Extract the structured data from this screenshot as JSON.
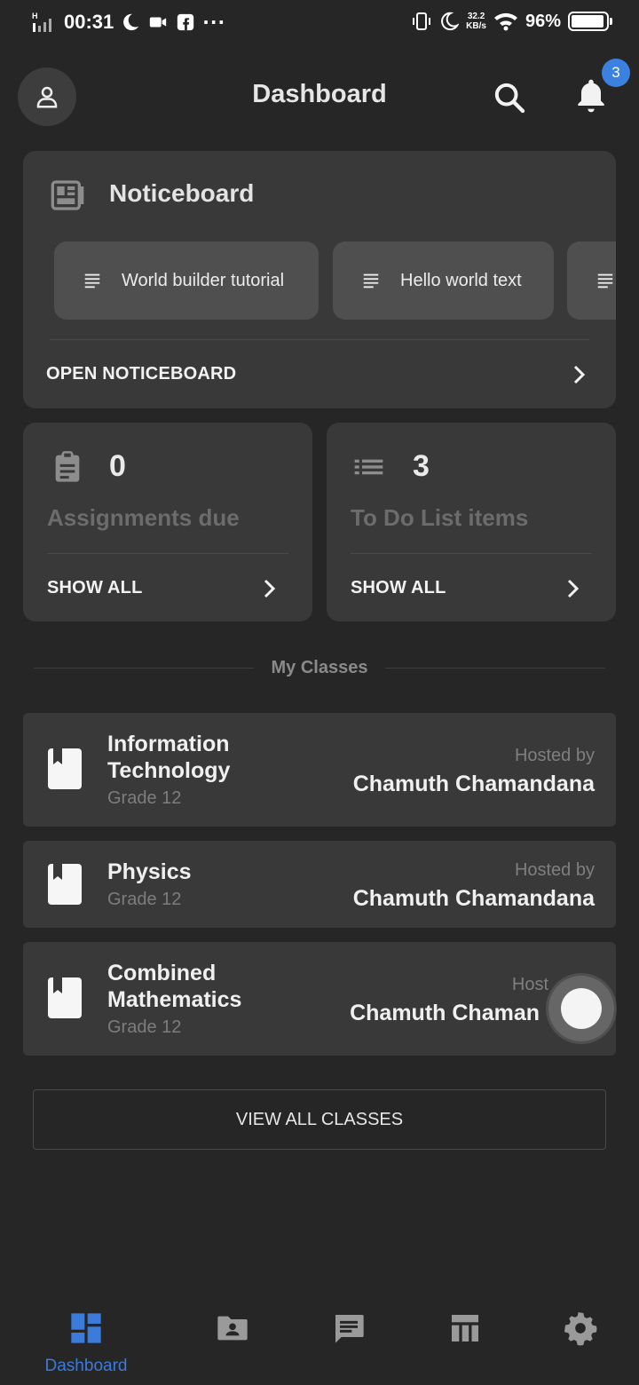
{
  "status_bar": {
    "time": "00:31",
    "dots": "···",
    "speed_value": "32.2",
    "speed_unit": "KB/s",
    "battery_pct": "96%",
    "battery_level": 0.96
  },
  "header": {
    "title": "Dashboard",
    "notification_count": "3",
    "accent_color": "#3b82e0"
  },
  "noticeboard": {
    "title": "Noticeboard",
    "notices": [
      {
        "label": "World builder tutorial"
      },
      {
        "label": "Hello world text"
      },
      {
        "label": ""
      }
    ],
    "open_label": "OPEN NOTICEBOARD"
  },
  "stats": {
    "assignments": {
      "count": "0",
      "label": "Assignments due",
      "action": "SHOW ALL"
    },
    "todo": {
      "count": "3",
      "label": "To Do List items",
      "action": "SHOW ALL"
    }
  },
  "classes": {
    "section_label": "My Classes",
    "items": [
      {
        "name": "Information Technology",
        "grade": "Grade 12",
        "hosted_by_label": "Hosted by",
        "host": "Chamuth Chamandana"
      },
      {
        "name": "Physics",
        "grade": "Grade 12",
        "hosted_by_label": "Hosted by",
        "host": "Chamuth Chamandana"
      },
      {
        "name": "Combined Mathematics",
        "grade": "Grade 12",
        "hosted_by_label": "Host",
        "host": "Chamuth Chaman"
      }
    ],
    "view_all_label": "VIEW ALL CLASSES"
  },
  "bottom_nav": {
    "items": [
      {
        "icon": "dashboard-icon",
        "label": "Dashboard",
        "active": true
      },
      {
        "icon": "folder-account-icon",
        "label": "",
        "active": false
      },
      {
        "icon": "chat-icon",
        "label": "",
        "active": false
      },
      {
        "icon": "timetable-icon",
        "label": "",
        "active": false
      },
      {
        "icon": "gear-icon",
        "label": "",
        "active": false
      }
    ],
    "active_color": "#3b7bd9"
  }
}
